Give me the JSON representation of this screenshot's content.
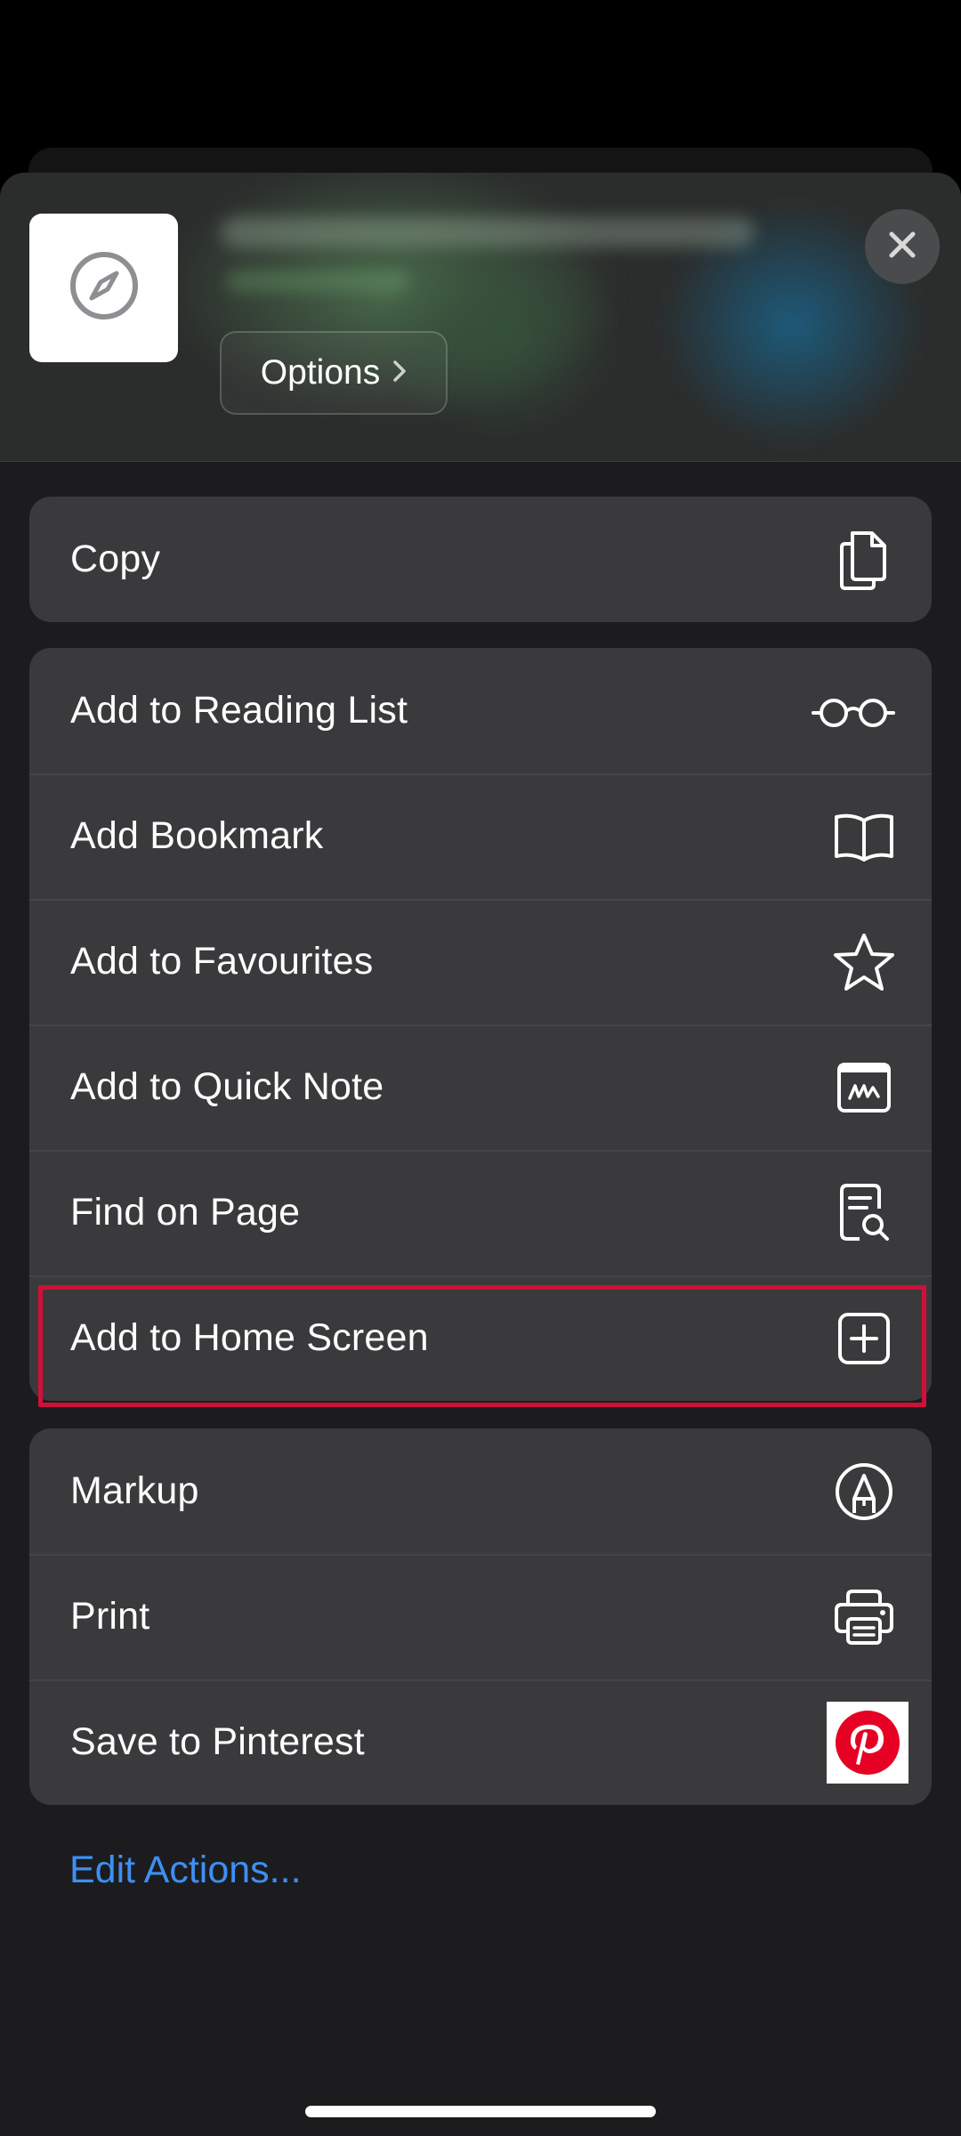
{
  "header": {
    "options_label": "Options",
    "site_icon": "compass-icon",
    "close_icon": "close-icon"
  },
  "groups": [
    {
      "rows": [
        {
          "label": "Copy",
          "icon": "copy-icon"
        }
      ]
    },
    {
      "rows": [
        {
          "label": "Add to Reading List",
          "icon": "glasses-icon"
        },
        {
          "label": "Add Bookmark",
          "icon": "book-icon"
        },
        {
          "label": "Add to Favourites",
          "icon": "star-icon"
        },
        {
          "label": "Add to Quick Note",
          "icon": "quick-note-icon"
        },
        {
          "label": "Find on Page",
          "icon": "find-doc-icon"
        },
        {
          "label": "Add to Home Screen",
          "icon": "plus-square-icon",
          "highlighted": true
        }
      ]
    },
    {
      "rows": [
        {
          "label": "Markup",
          "icon": "markup-icon"
        },
        {
          "label": "Print",
          "icon": "printer-icon"
        },
        {
          "label": "Save to Pinterest",
          "icon": "pinterest-icon"
        }
      ]
    }
  ],
  "edit_actions_label": "Edit Actions...",
  "colors": {
    "sheet_background": "#1c1c1e",
    "row_background": "#3a3a3c",
    "link_blue": "#3e8ff2",
    "highlight_red": "#d0103a",
    "pinterest_red": "#e60023"
  }
}
